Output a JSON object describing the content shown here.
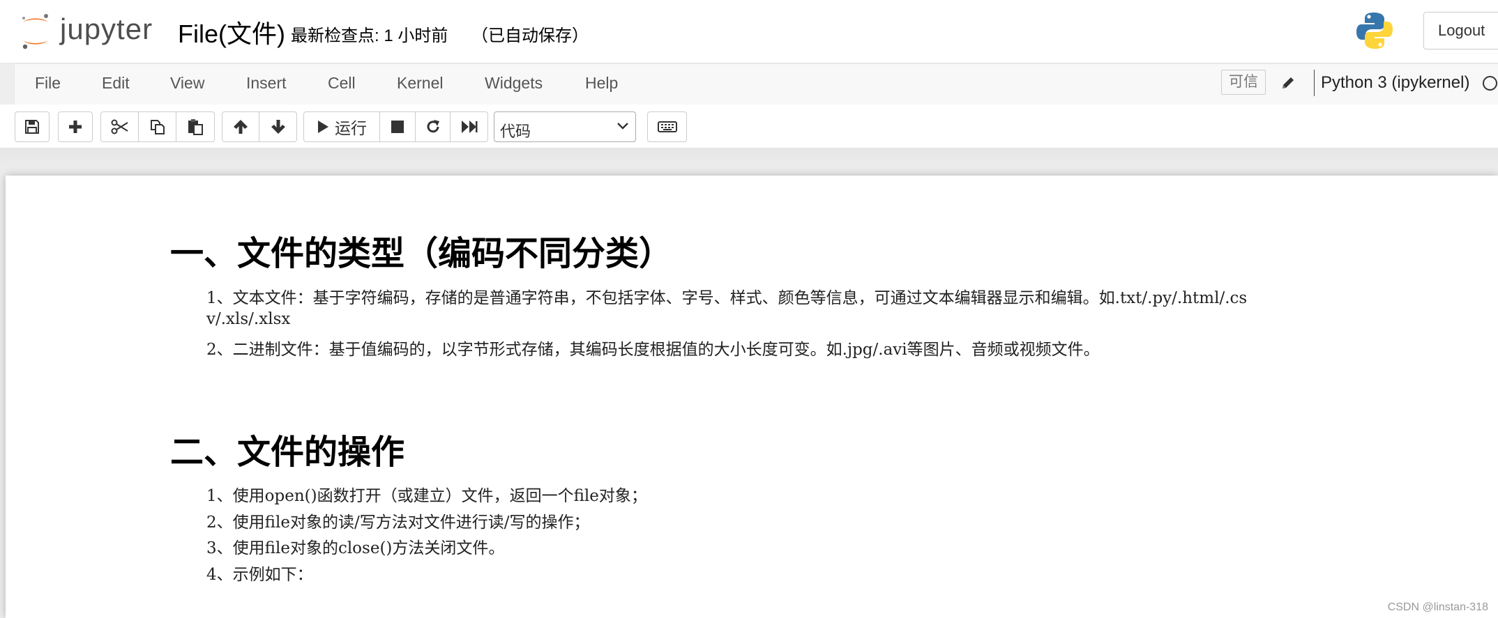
{
  "header": {
    "logo_text": "jupyter",
    "notebook_name": "File(文件)",
    "checkpoint": "最新检查点: 1 小时前",
    "autosave": "（已自动保存）",
    "logout_label": "Logout"
  },
  "menubar": {
    "items": [
      "File",
      "Edit",
      "View",
      "Insert",
      "Cell",
      "Kernel",
      "Widgets",
      "Help"
    ],
    "trusted_label": "可信",
    "kernel_name": "Python 3 (ipykernel)"
  },
  "toolbar": {
    "run_label": "运行",
    "cell_type": "代码",
    "icons": [
      "save-icon",
      "plus-icon",
      "scissors-icon",
      "copy-icon",
      "paste-icon",
      "arrow-up-icon",
      "arrow-down-icon",
      "play-icon",
      "stop-icon",
      "restart-icon",
      "fast-forward-icon",
      "keyboard-icon"
    ]
  },
  "notebook": {
    "section1": {
      "heading": "一、文件的类型（编码不同分类）",
      "lines": [
        "1、文本文件：基于字符编码，存储的是普通字符串，不包括字体、字号、样式、颜色等信息，可通过文本编辑器显示和编辑。如.txt/.py/.html/.cs",
        "v/.xls/.xlsx",
        "2、二进制文件：基于值编码的，以字节形式存储，其编码长度根据值的大小长度可变。如.jpg/.avi等图片、音频或视频文件。"
      ]
    },
    "section2": {
      "heading": "二、文件的操作",
      "lines": [
        "1、使用open()函数打开（或建立）文件，返回一个file对象；",
        "2、使用file对象的读/写方法对文件进行读/写的操作；",
        "3、使用file对象的close()方法关闭文件。",
        "4、示例如下："
      ]
    }
  },
  "watermark": "CSDN @linstan-318",
  "colors": {
    "jupyter_orange": "#F37726",
    "python_blue": "#3776AB",
    "python_yellow": "#FFD43B"
  }
}
